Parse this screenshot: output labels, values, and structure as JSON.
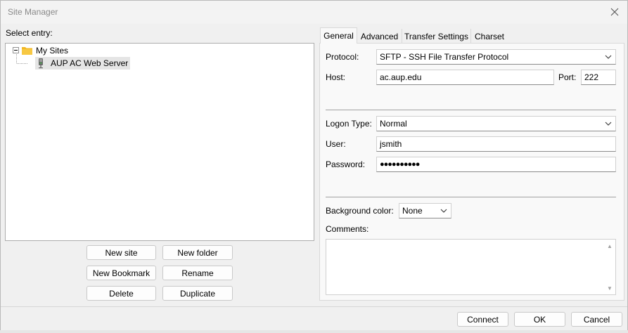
{
  "window": {
    "title": "Site Manager"
  },
  "left": {
    "select_entry_label": "Select entry:",
    "tree": {
      "root": {
        "label": "My Sites",
        "icon": "folder-icon"
      },
      "children": [
        {
          "label": "AUP AC Web Server",
          "icon": "server-icon",
          "selected": true
        }
      ]
    },
    "buttons": {
      "new_site": "New site",
      "new_folder": "New folder",
      "new_bookmark": "New Bookmark",
      "rename": "Rename",
      "delete": "Delete",
      "duplicate": "Duplicate"
    }
  },
  "tabs": [
    "General",
    "Advanced",
    "Transfer Settings",
    "Charset"
  ],
  "active_tab": "General",
  "general": {
    "protocol_label": "Protocol:",
    "protocol_value": "SFTP - SSH File Transfer Protocol",
    "host_label": "Host:",
    "host_value": "ac.aup.edu",
    "port_label": "Port:",
    "port_value": "222",
    "logon_type_label": "Logon Type:",
    "logon_type_value": "Normal",
    "user_label": "User:",
    "user_value": "jsmith",
    "password_label": "Password:",
    "password_value": "●●●●●●●●●●",
    "bg_color_label": "Background color:",
    "bg_color_value": "None",
    "comments_label": "Comments:",
    "comments_value": ""
  },
  "footer": {
    "connect": "Connect",
    "ok": "OK",
    "cancel": "Cancel"
  },
  "colors": {
    "folder": "#f2b824",
    "selection": "#e5e5e5",
    "window_bg": "#f0f0f0",
    "panel_bg": "#f9f9f9"
  }
}
